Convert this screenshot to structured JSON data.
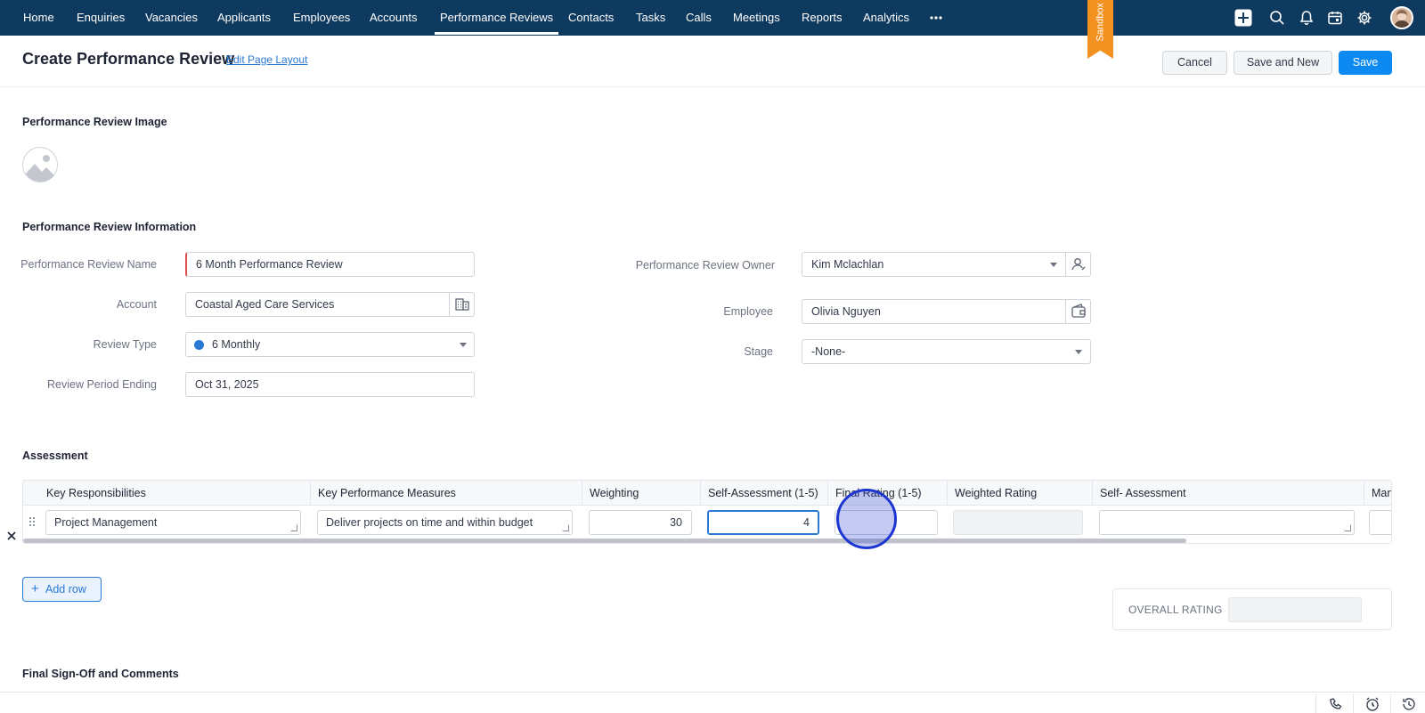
{
  "nav": {
    "items": [
      "Home",
      "Enquiries",
      "Vacancies",
      "Applicants",
      "Employees",
      "Accounts",
      "Performance Reviews",
      "Contacts",
      "Tasks",
      "Calls",
      "Meetings",
      "Reports",
      "Analytics"
    ],
    "active": "Performance Reviews",
    "sandbox_label": "Sandbox"
  },
  "header": {
    "title": "Create Performance Review",
    "edit_link": "Edit Page Layout",
    "cancel": "Cancel",
    "save_new": "Save and New",
    "save": "Save"
  },
  "sections": {
    "image": "Performance Review Image",
    "info": "Performance Review Information",
    "assessment": "Assessment",
    "signoff": "Final Sign-Off and Comments"
  },
  "fields": {
    "name": {
      "label": "Performance Review Name",
      "value": "6 Month Performance Review"
    },
    "account": {
      "label": "Account",
      "value": "Coastal Aged Care Services"
    },
    "review_type": {
      "label": "Review Type",
      "value": "6 Monthly"
    },
    "period_ending": {
      "label": "Review Period Ending",
      "value": "Oct 31, 2025"
    },
    "owner": {
      "label": "Performance Review Owner",
      "value": "Kim Mclachlan"
    },
    "employee": {
      "label": "Employee",
      "value": "Olivia Nguyen"
    },
    "stage": {
      "label": "Stage",
      "value": "-None-"
    }
  },
  "assessment": {
    "columns": [
      "Key Responsibilities",
      "Key Performance Measures",
      "Weighting",
      "Self-Assessment (1-5)",
      "Final Rating (1-5)",
      "Weighted Rating",
      "Self- Assessment",
      "Mana"
    ],
    "row": {
      "key_responsibility": "Project Management",
      "key_measure": "Deliver projects on time and within budget",
      "weighting": "30",
      "self_assessment": "4",
      "final_rating": "",
      "weighted_rating": "",
      "self_assessment_text": ""
    },
    "add_row": "Add row",
    "overall_rating_label": "OVERALL RATING",
    "overall_rating_value": ""
  },
  "colors": {
    "nav_bg": "#0f3a5f",
    "primary": "#0c8af2",
    "sandbox": "#f39221",
    "review_type_dot": "#2a7ad5",
    "cursor": "#1d35d1"
  }
}
